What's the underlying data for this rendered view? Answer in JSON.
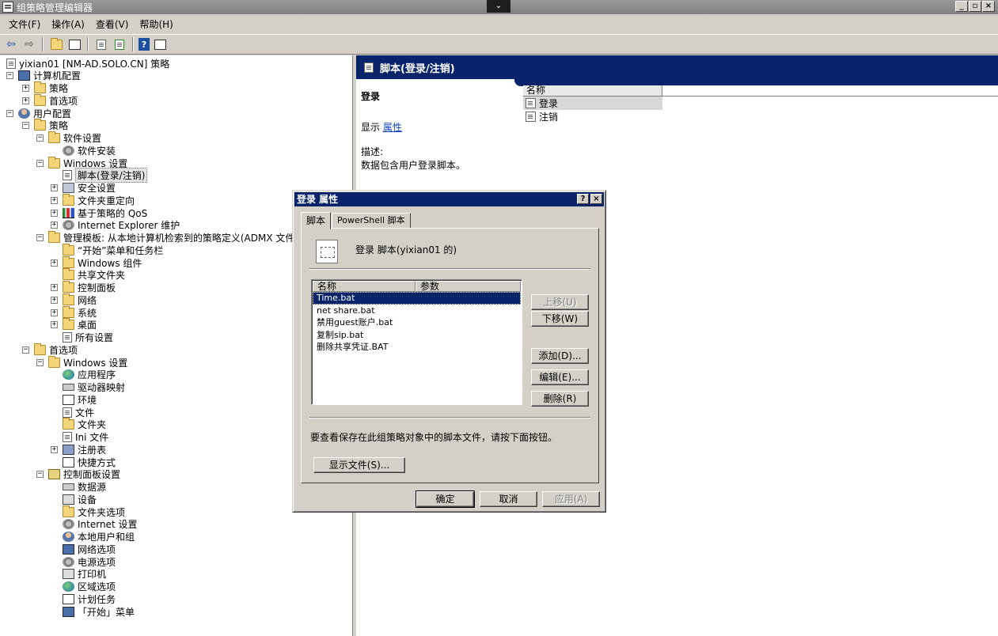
{
  "window": {
    "title": "组策略管理编辑器",
    "chevron": "⌄",
    "min": "_",
    "max": "▫",
    "close": "×"
  },
  "menu": [
    "文件(F)",
    "操作(A)",
    "查看(V)",
    "帮助(H)"
  ],
  "toolbar": [
    "back-icon",
    "forward-icon",
    "up-icon",
    "show-tree-icon",
    "properties-icon",
    "export-icon",
    "help-icon",
    "show-action-pane-icon"
  ],
  "tree": [
    {
      "label": "yixian01 [NM-AD.SOLO.CN] 策略",
      "icon": "doc",
      "level": 0,
      "exp": ""
    },
    {
      "label": "计算机配置",
      "icon": "comp",
      "level": 0,
      "exp": "−"
    },
    {
      "label": "策略",
      "icon": "folder",
      "level": 1,
      "exp": "+"
    },
    {
      "label": "首选项",
      "icon": "folder",
      "level": 1,
      "exp": "+"
    },
    {
      "label": "用户配置",
      "icon": "user",
      "level": 0,
      "exp": "−"
    },
    {
      "label": "策略",
      "icon": "folder",
      "level": 1,
      "exp": "−"
    },
    {
      "label": "软件设置",
      "icon": "folder",
      "level": 2,
      "exp": "−"
    },
    {
      "label": "软件安装",
      "icon": "gear",
      "level": 3,
      "exp": ""
    },
    {
      "label": "Windows 设置",
      "icon": "folder",
      "level": 2,
      "exp": "−"
    },
    {
      "label": "脚本(登录/注销)",
      "icon": "doc",
      "level": 3,
      "exp": "",
      "selected": true
    },
    {
      "label": "安全设置",
      "icon": "shield",
      "level": 3,
      "exp": "+"
    },
    {
      "label": "文件夹重定向",
      "icon": "folder",
      "level": 3,
      "exp": "+"
    },
    {
      "label": "基于策略的 QoS",
      "icon": "chart",
      "level": 3,
      "exp": "+"
    },
    {
      "label": "Internet Explorer 维护",
      "icon": "gear",
      "level": 3,
      "exp": "+"
    },
    {
      "label": "管理模板: 从本地计算机检索到的策略定义(ADMX 文件)",
      "icon": "folder",
      "level": 2,
      "exp": "−"
    },
    {
      "label": "“开始”菜单和任务栏",
      "icon": "folder",
      "level": 3,
      "exp": ""
    },
    {
      "label": "Windows 组件",
      "icon": "folder",
      "level": 3,
      "exp": "+"
    },
    {
      "label": "共享文件夹",
      "icon": "folder",
      "level": 3,
      "exp": ""
    },
    {
      "label": "控制面板",
      "icon": "folder",
      "level": 3,
      "exp": "+"
    },
    {
      "label": "网络",
      "icon": "folder",
      "level": 3,
      "exp": "+"
    },
    {
      "label": "系统",
      "icon": "folder",
      "level": 3,
      "exp": "+"
    },
    {
      "label": "桌面",
      "icon": "folder",
      "level": 3,
      "exp": "+"
    },
    {
      "label": "所有设置",
      "icon": "doc",
      "level": 3,
      "exp": ""
    },
    {
      "label": "首选项",
      "icon": "folder",
      "level": 1,
      "exp": "−"
    },
    {
      "label": "Windows 设置",
      "icon": "folder",
      "level": 2,
      "exp": "−"
    },
    {
      "label": "应用程序",
      "icon": "globe",
      "level": 3,
      "exp": ""
    },
    {
      "label": "驱动器映射",
      "icon": "drive",
      "level": 3,
      "exp": ""
    },
    {
      "label": "环境",
      "icon": "task",
      "level": 3,
      "exp": ""
    },
    {
      "label": "文件",
      "icon": "doc",
      "level": 3,
      "exp": ""
    },
    {
      "label": "文件夹",
      "icon": "folder",
      "level": 3,
      "exp": ""
    },
    {
      "label": "Ini 文件",
      "icon": "doc",
      "level": 3,
      "exp": ""
    },
    {
      "label": "注册表",
      "icon": "key",
      "level": 3,
      "exp": "+"
    },
    {
      "label": "快捷方式",
      "icon": "shortcut",
      "level": 3,
      "exp": ""
    },
    {
      "label": "控制面板设置",
      "icon": "cpanel",
      "level": 2,
      "exp": "−"
    },
    {
      "label": "数据源",
      "icon": "drive",
      "level": 3,
      "exp": ""
    },
    {
      "label": "设备",
      "icon": "printer",
      "level": 3,
      "exp": ""
    },
    {
      "label": "文件夹选项",
      "icon": "folder",
      "level": 3,
      "exp": ""
    },
    {
      "label": "Internet 设置",
      "icon": "gear",
      "level": 3,
      "exp": ""
    },
    {
      "label": "本地用户和组",
      "icon": "user",
      "level": 3,
      "exp": ""
    },
    {
      "label": "网络选项",
      "icon": "comp",
      "level": 3,
      "exp": ""
    },
    {
      "label": "电源选项",
      "icon": "gear",
      "level": 3,
      "exp": ""
    },
    {
      "label": "打印机",
      "icon": "printer",
      "level": 3,
      "exp": ""
    },
    {
      "label": "区域选项",
      "icon": "globe",
      "level": 3,
      "exp": ""
    },
    {
      "label": "计划任务",
      "icon": "task",
      "level": 3,
      "exp": ""
    },
    {
      "label": "「开始」菜单",
      "icon": "comp",
      "level": 3,
      "exp": ""
    }
  ],
  "right": {
    "header": "脚本(登录/注销)",
    "ext_title": "登录",
    "ext_action_prefix": "显示",
    "ext_action_link": "属性",
    "ext_desc_label": "描述:",
    "ext_desc": "数据包含用户登录脚本。",
    "list_header": "名称",
    "items": [
      "登录",
      "注销"
    ]
  },
  "dialog": {
    "title": "登录 属性",
    "help": "?",
    "close": "×",
    "tabs": [
      "脚本",
      "PowerShell 脚本"
    ],
    "heading": "登录 脚本(yixian01 的)",
    "col_name": "名称",
    "col_params": "参数",
    "scripts": [
      "Time.bat",
      "net share.bat",
      "禁用guest账户.bat",
      "复制sip.bat",
      "删除共享凭证.BAT"
    ],
    "btn_up": "上移(U)",
    "btn_down": "下移(W)",
    "btn_add": "添加(D)...",
    "btn_edit": "编辑(E)...",
    "btn_remove": "删除(R)",
    "note": "要查看保存在此组策略对象中的脚本文件，请按下面按钮。",
    "btn_show": "显示文件(S)...",
    "btn_ok": "确定",
    "btn_cancel": "取消",
    "btn_apply": "应用(A)"
  }
}
